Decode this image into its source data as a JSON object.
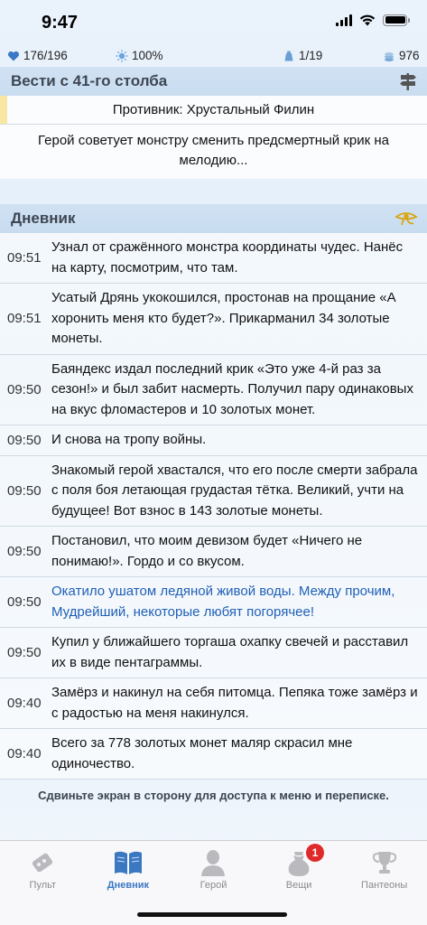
{
  "status": {
    "time": "9:47"
  },
  "stats": {
    "health": "176/196",
    "godpower": "100%",
    "quest": "1/19",
    "gold": "976"
  },
  "news": {
    "title": "Вести с 41-го столба",
    "opponent": "Противник: Хрустальный Филин",
    "text": "Герой советует монстру сменить предсмертный крик на мелодию..."
  },
  "diary": {
    "title": "Дневник",
    "entries": [
      {
        "time": "09:51",
        "text": "Узнал от сражённого монстра координаты чудес. Нанёс на карту, посмотрим, что там."
      },
      {
        "time": "09:51",
        "text": "Усатый Дрянь укокошился, простонав на прощание «А хоронить меня кто будет?». Прикарманил 34 золотые монеты."
      },
      {
        "time": "09:50",
        "text": "Баяндекс издал последний крик «Это уже 4-й раз за сезон!» и был забит насмерть. Получил пару одинаковых на вкус фломастеров и 10 золотых монет."
      },
      {
        "time": "09:50",
        "text": "И снова на тропу войны."
      },
      {
        "time": "09:50",
        "text": "Знакомый герой хвастался, что его после смерти забрала с поля боя летающая грудастая тётка. Великий, учти на будущее! Вот взнос в 143 золотые монеты."
      },
      {
        "time": "09:50",
        "text": "Постановил, что моим девизом будет «Ничего не понимаю!». Гордо и со вкусом."
      },
      {
        "time": "09:50",
        "text": "Окатило ушатом ледяной живой воды. Между прочим, Мудрейший, некоторые любят погорячее!"
      },
      {
        "time": "09:50",
        "text": "Купил у ближайшего торгаша охапку свечей и расставил их в виде пентаграммы."
      },
      {
        "time": "09:40",
        "text": "Замёрз и накинул на себя питомца. Пепяка тоже замёрз и с радостью на меня накинулся."
      },
      {
        "time": "09:40",
        "text": "Всего за 778 золотых монет маляр скрасил мне одиночество."
      }
    ],
    "hint": "Сдвиньте экран в сторону для доступа к меню и переписке."
  },
  "tabs": [
    {
      "label": "Пульт",
      "icon": "remote-icon"
    },
    {
      "label": "Дневник",
      "icon": "book-icon"
    },
    {
      "label": "Герой",
      "icon": "hero-icon"
    },
    {
      "label": "Вещи",
      "icon": "bag-icon",
      "badge": "1"
    },
    {
      "label": "Пантеоны",
      "icon": "trophy-icon"
    }
  ],
  "colors": {
    "accent": "#3a78c2",
    "divine": "#1f5fb5",
    "badge": "#e02a2a"
  }
}
